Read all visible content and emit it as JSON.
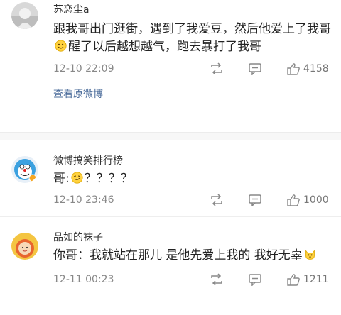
{
  "comments": [
    {
      "username": "苏恋尘a",
      "text_a": "跟我哥出门逛街，遇到了我爱豆，然后他爱上了我哥",
      "text_b": "醒了以后越想越气，跑去暴打了我哥",
      "emoji": "smiley-emoji",
      "time": "12-10 22:09",
      "likes": "4158",
      "view_original": "查看原微博"
    },
    {
      "username": "微博搞笑排行榜",
      "text_a": "哥:",
      "text_b": "？？？？",
      "emoji": "grin-emoji",
      "time": "12-10 23:46",
      "likes": "1000"
    },
    {
      "username": "品如的袜子",
      "text_a": "你哥：我就站在那儿 是他先爱上我的 我好无辜",
      "text_b": "",
      "emoji": "cat-emoji",
      "time": "12-11 00:23",
      "likes": "1211"
    }
  ],
  "colors": {
    "link": "#4a6b9a",
    "meta": "#888888",
    "icon": "#777777"
  }
}
